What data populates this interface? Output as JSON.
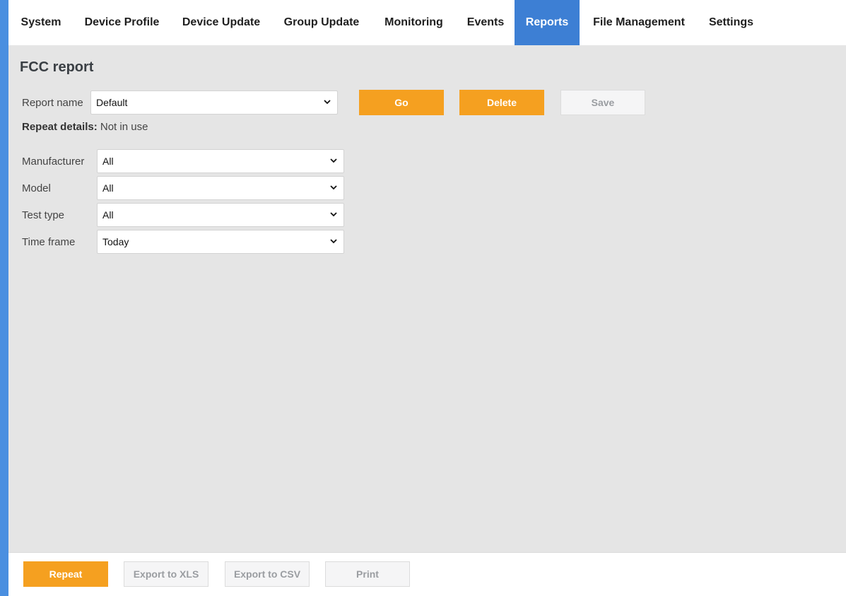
{
  "nav": {
    "tabs": [
      {
        "label": "System"
      },
      {
        "label": "Device Profile"
      },
      {
        "label": "Device Update"
      },
      {
        "label": "Group Update"
      },
      {
        "label": "Monitoring"
      },
      {
        "label": "Events"
      },
      {
        "label": "Reports",
        "active": true
      },
      {
        "label": "File Management"
      },
      {
        "label": "Settings"
      }
    ]
  },
  "page": {
    "title": "FCC report"
  },
  "report": {
    "name_label": "Report name",
    "name_value": "Default",
    "go_label": "Go",
    "delete_label": "Delete",
    "save_label": "Save",
    "repeat_details_label": "Repeat details:",
    "repeat_details_value": "Not in use"
  },
  "filters": {
    "manufacturer": {
      "label": "Manufacturer",
      "value": "All"
    },
    "model": {
      "label": "Model",
      "value": "All"
    },
    "test_type": {
      "label": "Test type",
      "value": "All"
    },
    "time_frame": {
      "label": "Time frame",
      "value": "Today"
    }
  },
  "footer": {
    "repeat_label": "Repeat",
    "export_xls_label": "Export to XLS",
    "export_csv_label": "Export to CSV",
    "print_label": "Print"
  },
  "colors": {
    "accent_blue": "#3d7fd4",
    "left_bar": "#4a8fe0",
    "orange": "#f5a020",
    "content_bg": "#e5e5e5"
  }
}
